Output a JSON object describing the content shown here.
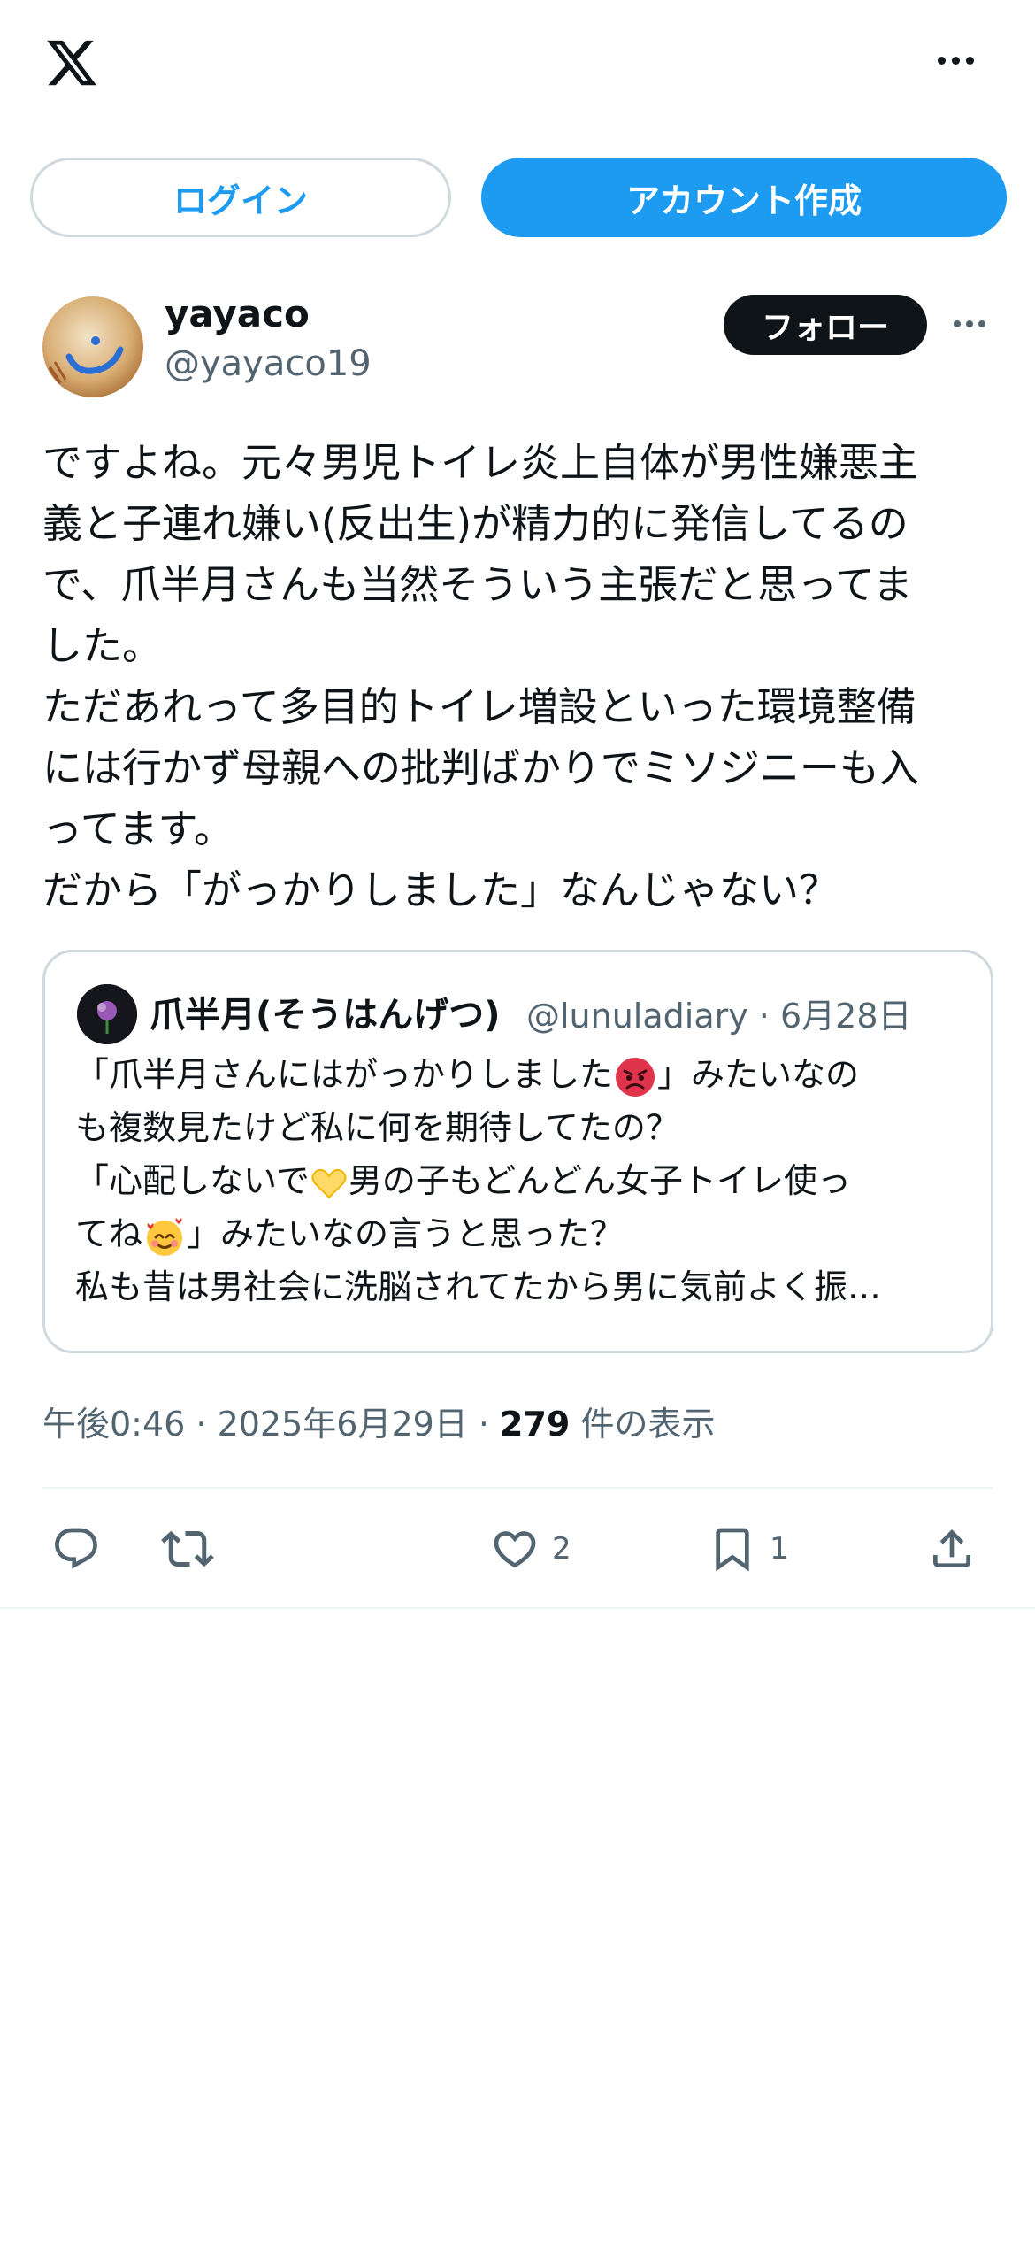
{
  "header": {
    "logo_icon": "x-logo-icon",
    "more_icon": "more-horizontal-icon"
  },
  "auth": {
    "login_label": "ログイン",
    "signup_label": "アカウント作成"
  },
  "tweet": {
    "display_name": "yayaco",
    "handle": "@yayaco19",
    "follow_label": "フォロー",
    "text": "ですよね。元々男児トイレ炎上自体が男性嫌悪主\n義と子連れ嫌い(反出生)が精力的に発信してるの\nで、爪半月さんも当然そういう主張だと思ってま\nした。\nただあれって多目的トイレ増設といった環境整備\nには行かず母親への批判ばかりでミソジニーも入\nってます。\nだから「がっかりしました」なんじゃない？",
    "timestamp": "午後0:46 · 2025年6月29日 · ",
    "views_count": "279",
    "views_label": " 件の表示"
  },
  "quote": {
    "display_name": "爪半月(そうはんげつ)",
    "meta": "@lunuladiary · 6月28日",
    "line1_a": "「爪半月さんにはがっかりしました",
    "line1_b": "」みたいなの",
    "line2": "も複数見たけど私に何を期待してたの？",
    "line3_a": "「心配しないで",
    "line3_b": "男の子もどんどん女子トイレ使っ",
    "line4_a": "てね",
    "line4_b": "」みたいなの言うと思った？",
    "line5": "私も昔は男社会に洗脳されてたから男に気前よく振…"
  },
  "actions": {
    "reply_icon": "reply-icon",
    "retweet_icon": "retweet-icon",
    "like_icon": "heart-icon",
    "like_count": "2",
    "bookmark_icon": "bookmark-icon",
    "bookmark_count": "1",
    "share_icon": "share-icon"
  },
  "colors": {
    "accent": "#1d9bf0",
    "text": "#0f1419",
    "secondary": "#536471",
    "border": "#cfd9de"
  }
}
